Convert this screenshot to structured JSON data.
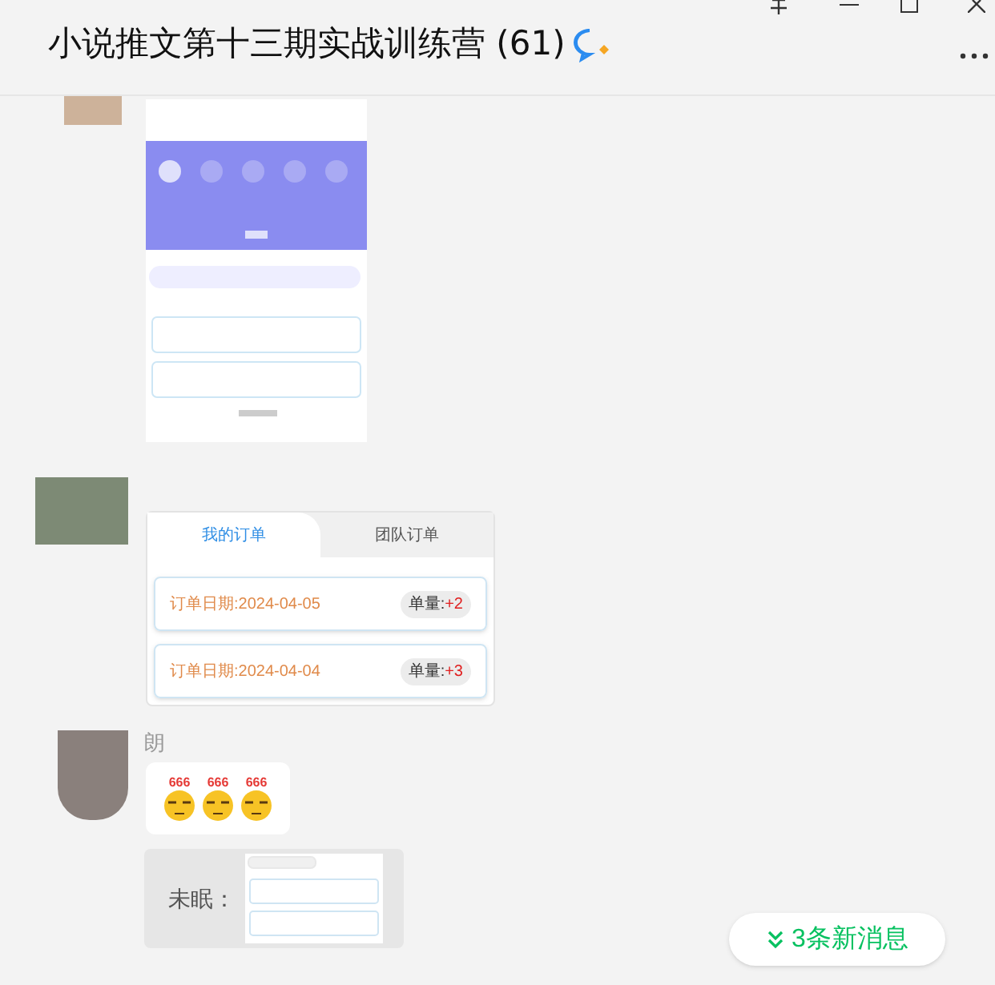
{
  "window": {
    "title": "小说推文第十三期实战训练营 (61)"
  },
  "messages": [
    {
      "kind": "thumbnail"
    },
    {
      "kind": "orders",
      "tabs": [
        {
          "label": "我的订单",
          "selected": true
        },
        {
          "label": "团队订单",
          "selected": false
        }
      ],
      "orders": [
        {
          "date": "订单日期:2024-04-05",
          "qty_label": "单量:",
          "qty": "+2"
        },
        {
          "date": "订单日期:2024-04-04",
          "qty_label": "单量:",
          "qty": "+3"
        }
      ]
    },
    {
      "kind": "emoji",
      "sender": "朗",
      "emojis": [
        {
          "badge": "666"
        },
        {
          "badge": "666"
        },
        {
          "badge": "666"
        }
      ]
    },
    {
      "kind": "quote",
      "quoted_sender": "未眠："
    }
  ],
  "new_messages": "3条新消息"
}
